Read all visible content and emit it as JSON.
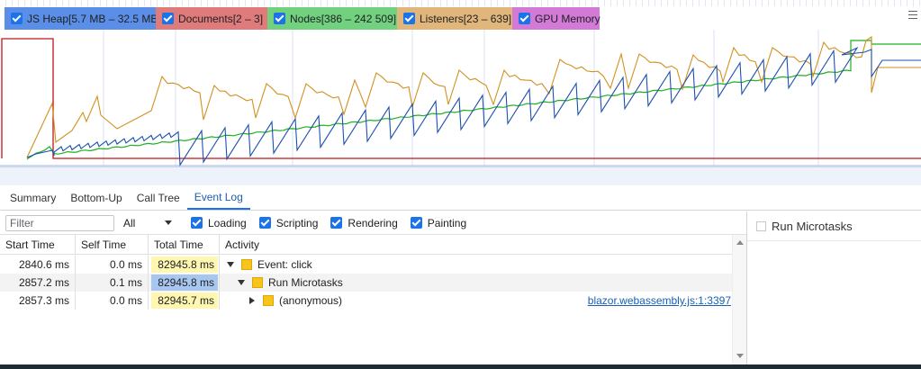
{
  "counters": [
    {
      "label": "JS Heap[5.7 MB – 32.5 MB]",
      "color": "#5b8ee6",
      "text_color": "#202124",
      "checked": true
    },
    {
      "label": "Documents[2 – 3]",
      "color": "#e07b7b",
      "text_color": "#202124",
      "checked": true
    },
    {
      "label": "Nodes[386 – 242 509]",
      "color": "#72d17f",
      "text_color": "#202124",
      "checked": true
    },
    {
      "label": "Listeners[23 – 639]",
      "color": "#e0b67a",
      "text_color": "#202124",
      "checked": true
    },
    {
      "label": "GPU Memory",
      "color": "#d37ad7",
      "text_color": "#202124",
      "checked": true
    }
  ],
  "chart_colors": {
    "heap": "#1c50b0",
    "documents": "#c0151a",
    "nodes": "#1fb020",
    "listeners": "#d2901f",
    "grid": "#d9e3f3"
  },
  "tabs": [
    "Summary",
    "Bottom-Up",
    "Call Tree",
    "Event Log"
  ],
  "active_tab": "Event Log",
  "filter": {
    "placeholder": "Filter",
    "value": ""
  },
  "select": {
    "value": "All"
  },
  "checkboxes": [
    "Loading",
    "Scripting",
    "Rendering",
    "Painting"
  ],
  "columns": [
    "Start Time",
    "Self Time",
    "Total Time",
    "Activity"
  ],
  "rows": [
    {
      "start": "2840.6 ms",
      "self": "0.0 ms",
      "total": "82945.8 ms",
      "activity": "Event: click",
      "expander": "down",
      "indent": 0,
      "link": "",
      "selected": false
    },
    {
      "start": "2857.2 ms",
      "self": "0.1 ms",
      "total": "82945.8 ms",
      "activity": "Run Microtasks",
      "expander": "down",
      "indent": 1,
      "link": "",
      "selected": true
    },
    {
      "start": "2857.3 ms",
      "self": "0.0 ms",
      "total": "82945.7 ms",
      "activity": "(anonymous)",
      "expander": "right",
      "indent": 2,
      "link": "blazor.webassembly.js:1:3397",
      "selected": false
    }
  ],
  "details": {
    "title": "Run Microtasks"
  }
}
